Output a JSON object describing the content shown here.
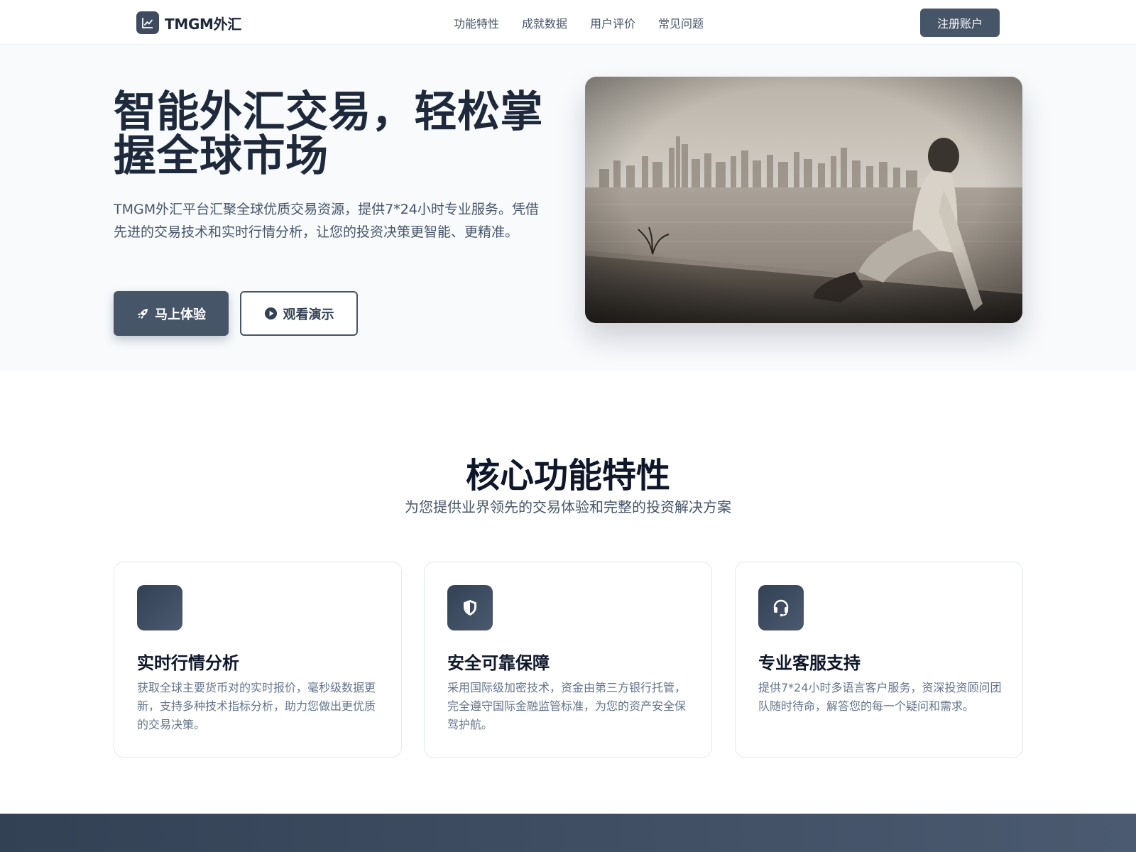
{
  "brand": {
    "name": "TMGM外汇",
    "icon": "chart-line-icon"
  },
  "nav": {
    "links": [
      "功能特性",
      "成就数据",
      "用户评价",
      "常见问题"
    ],
    "cta": "注册账户"
  },
  "hero": {
    "title": "智能外汇交易，轻松掌握全球市场",
    "description": "TMGM外汇平台汇聚全球优质交易资源，提供7*24小时专业服务。凭借先进的交易技术和实时行情分析，让您的投资决策更智能、更精准。",
    "primary_button": {
      "label": "马上体验",
      "icon": "rocket-icon"
    },
    "secondary_button": {
      "label": "观看演示",
      "icon": "play-circle-icon"
    }
  },
  "features": {
    "title": "核心功能特性",
    "subtitle": "为您提供业界领先的交易体验和完整的投资解决方案",
    "cards": [
      {
        "icon": "chart-icon",
        "title": "实时行情分析",
        "description": "获取全球主要货币对的实时报价，毫秒级数据更新，支持多种技术指标分析，助力您做出更优质的交易决策。"
      },
      {
        "icon": "shield-icon",
        "title": "安全可靠保障",
        "description": "采用国际级加密技术，资金由第三方银行托管，完全遵守国际金融监管标准，为您的资产安全保驾护航。"
      },
      {
        "icon": "headset-icon",
        "title": "专业客服支持",
        "description": "提供7*24小时多语言客户服务，资深投资顾问团队随时待命，解答您的每一个疑问和需求。"
      }
    ]
  },
  "colors": {
    "primary": "#475569",
    "dark": "#1e293b",
    "hero_bg": "#f8fafc"
  }
}
